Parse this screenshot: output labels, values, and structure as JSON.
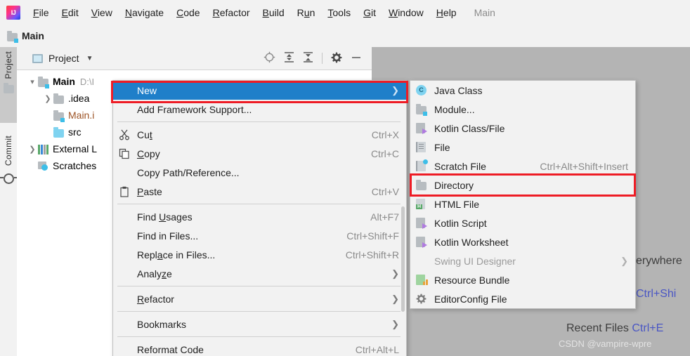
{
  "window": {
    "menubar": [
      {
        "label": "File",
        "mnemonic": "F"
      },
      {
        "label": "Edit",
        "mnemonic": "E"
      },
      {
        "label": "View",
        "mnemonic": "V"
      },
      {
        "label": "Navigate",
        "mnemonic": "N"
      },
      {
        "label": "Code",
        "mnemonic": "C"
      },
      {
        "label": "Refactor",
        "mnemonic": "R"
      },
      {
        "label": "Build",
        "mnemonic": "B"
      },
      {
        "label": "Run",
        "mnemonic": "u"
      },
      {
        "label": "Tools",
        "mnemonic": "T"
      },
      {
        "label": "Git",
        "mnemonic": "G"
      },
      {
        "label": "Window",
        "mnemonic": "W"
      },
      {
        "label": "Help",
        "mnemonic": "H"
      }
    ],
    "context_project": "Main",
    "logo_text": "IJ"
  },
  "breadcrumb": {
    "project_name": "Main",
    "icon": "module-folder-icon"
  },
  "tool_strip": {
    "tabs": [
      {
        "label": "Project",
        "icon": "folder-icon",
        "active": true
      },
      {
        "label": "Commit",
        "icon": "commit-icon",
        "active": false
      }
    ]
  },
  "project_panel": {
    "title": "Project",
    "dropdown_icon": "chevron-down-icon",
    "toolbar_icons": [
      {
        "name": "select-opened-file-icon"
      },
      {
        "name": "expand-all-icon"
      },
      {
        "name": "collapse-all-icon"
      },
      {
        "name": "settings-gear-icon"
      },
      {
        "name": "hide-panel-icon"
      }
    ],
    "tree": [
      {
        "label": "Main",
        "path": "D:\\I",
        "icon": "module-folder-icon",
        "arrow": "expanded",
        "indent": 0,
        "bold": true,
        "style": "normal"
      },
      {
        "label": ".idea",
        "path": "",
        "icon": "folder-gray-icon",
        "arrow": "collapsed",
        "indent": 1,
        "bold": false,
        "style": "normal"
      },
      {
        "label": "Main.i",
        "path": "",
        "icon": "iml-file-icon",
        "arrow": "none",
        "indent": 1,
        "bold": false,
        "style": "iml"
      },
      {
        "label": "src",
        "path": "",
        "icon": "folder-blue-icon",
        "arrow": "none",
        "indent": 1,
        "bold": false,
        "style": "normal"
      },
      {
        "label": "External L",
        "path": "",
        "icon": "library-icon",
        "arrow": "collapsed",
        "indent": 0,
        "bold": false,
        "style": "normal"
      },
      {
        "label": "Scratches",
        "path": "",
        "icon": "scratches-icon",
        "arrow": "none",
        "indent": 0,
        "bold": false,
        "style": "normal"
      }
    ]
  },
  "context_menu": {
    "items": [
      {
        "type": "item",
        "label": "New",
        "accel": "",
        "icon": "",
        "arrow": true,
        "selected": true,
        "disabled": false,
        "indent": true
      },
      {
        "type": "item",
        "label": "Add Framework Support...",
        "accel": "",
        "icon": "",
        "arrow": false,
        "selected": false,
        "disabled": false,
        "indent": true
      },
      {
        "type": "separator"
      },
      {
        "type": "item",
        "label": "Cut",
        "mnemonic": "t",
        "accel": "Ctrl+X",
        "icon": "cut-icon",
        "arrow": false,
        "selected": false,
        "disabled": false,
        "indent": false
      },
      {
        "type": "item",
        "label": "Copy",
        "mnemonic": "C",
        "accel": "Ctrl+C",
        "icon": "copy-icon",
        "arrow": false,
        "selected": false,
        "disabled": false,
        "indent": false
      },
      {
        "type": "item",
        "label": "Copy Path/Reference...",
        "accel": "",
        "icon": "",
        "arrow": false,
        "selected": false,
        "disabled": false,
        "indent": true
      },
      {
        "type": "item",
        "label": "Paste",
        "mnemonic": "P",
        "accel": "Ctrl+V",
        "icon": "paste-icon",
        "arrow": false,
        "selected": false,
        "disabled": false,
        "indent": false
      },
      {
        "type": "separator"
      },
      {
        "type": "item",
        "label": "Find Usages",
        "mnemonic": "U",
        "accel": "Alt+F7",
        "icon": "",
        "arrow": false,
        "selected": false,
        "disabled": false,
        "indent": true
      },
      {
        "type": "item",
        "label": "Find in Files...",
        "accel": "Ctrl+Shift+F",
        "icon": "",
        "arrow": false,
        "selected": false,
        "disabled": false,
        "indent": true
      },
      {
        "type": "item",
        "label": "Replace in Files...",
        "mnemonic": "a",
        "accel": "Ctrl+Shift+R",
        "icon": "",
        "arrow": false,
        "selected": false,
        "disabled": false,
        "indent": true
      },
      {
        "type": "item",
        "label": "Analyze",
        "mnemonic": "z",
        "accel": "",
        "icon": "",
        "arrow": true,
        "selected": false,
        "disabled": false,
        "indent": true
      },
      {
        "type": "separator"
      },
      {
        "type": "item",
        "label": "Refactor",
        "mnemonic": "R",
        "accel": "",
        "icon": "",
        "arrow": true,
        "selected": false,
        "disabled": false,
        "indent": true
      },
      {
        "type": "separator"
      },
      {
        "type": "item",
        "label": "Bookmarks",
        "accel": "",
        "icon": "",
        "arrow": true,
        "selected": false,
        "disabled": false,
        "indent": true
      },
      {
        "type": "separator"
      },
      {
        "type": "item",
        "label": "Reformat Code",
        "accel": "Ctrl+Alt+L",
        "icon": "",
        "arrow": false,
        "selected": false,
        "disabled": false,
        "indent": true
      }
    ]
  },
  "submenu": {
    "items": [
      {
        "label": "Java Class",
        "accel": "",
        "icon": "java-class-icon",
        "arrow": false,
        "disabled": false
      },
      {
        "label": "Module...",
        "accel": "",
        "icon": "module-folder-icon",
        "arrow": false,
        "disabled": false
      },
      {
        "label": "Kotlin Class/File",
        "accel": "",
        "icon": "kotlin-file-icon",
        "arrow": false,
        "disabled": false
      },
      {
        "label": "File",
        "accel": "",
        "icon": "file-icon",
        "arrow": false,
        "disabled": false
      },
      {
        "label": "Scratch File",
        "accel": "Ctrl+Alt+Shift+Insert",
        "icon": "scratch-file-icon",
        "arrow": false,
        "disabled": false
      },
      {
        "label": "Directory",
        "accel": "",
        "icon": "folder-gray-icon",
        "arrow": false,
        "disabled": false
      },
      {
        "label": "HTML File",
        "accel": "",
        "icon": "html-file-icon",
        "arrow": false,
        "disabled": false
      },
      {
        "label": "Kotlin Script",
        "accel": "",
        "icon": "kotlin-file-icon",
        "arrow": false,
        "disabled": false
      },
      {
        "label": "Kotlin Worksheet",
        "accel": "",
        "icon": "kotlin-file-icon",
        "arrow": false,
        "disabled": false
      },
      {
        "label": "Swing UI Designer",
        "accel": "",
        "icon": "",
        "arrow": true,
        "disabled": true
      },
      {
        "label": "Resource Bundle",
        "accel": "",
        "icon": "resource-bundle-icon",
        "arrow": false,
        "disabled": false
      },
      {
        "label": "EditorConfig File",
        "accel": "",
        "icon": "gear-icon",
        "arrow": false,
        "disabled": false
      }
    ]
  },
  "editor_hints": {
    "search_everywhere": "erywhere",
    "search_everywhere_shortcut": "Ctrl+Shi",
    "recent_files_label": "Recent Files",
    "recent_files_shortcut": "Ctrl+E",
    "watermark": "CSDN @vampire-wpre"
  },
  "annotations": {
    "box_new_target": "New",
    "box_directory_target": "Directory",
    "box_color": "#ee1c25"
  },
  "colors": {
    "selection_blue": "#1f7fc9",
    "annotation_red": "#ee1c25",
    "editor_bg": "#b4b4b4",
    "menu_bg": "#f2f2f2",
    "panel_bg": "#ffffff",
    "hint_link_blue": "#4a56c4"
  }
}
